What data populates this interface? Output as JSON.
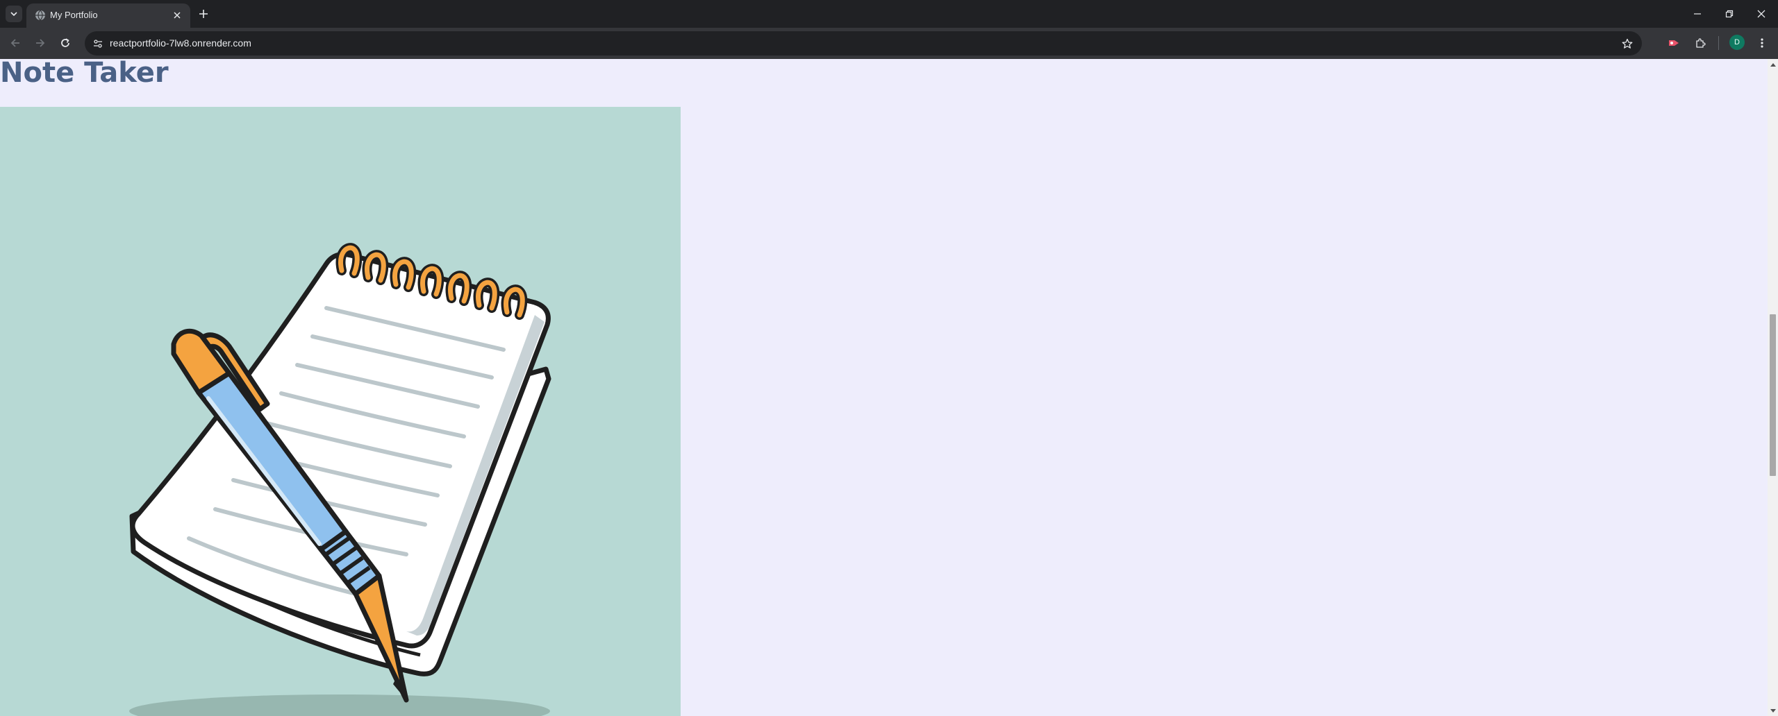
{
  "browser": {
    "tab": {
      "title": "My Portfolio"
    },
    "address_bar": {
      "url": "reactportfolio-7lw8.onrender.com"
    },
    "profile": {
      "initial": "D",
      "color": "#0f7a61"
    },
    "icons": [
      "tab-search-icon",
      "globe-icon",
      "close-icon",
      "plus-icon",
      "minimize-icon",
      "restore-icon",
      "back-arrow-icon",
      "forward-arrow-icon",
      "reload-icon",
      "site-info-icon",
      "star-icon",
      "extension-icon",
      "puzzle-icon",
      "kebab-menu-icon"
    ]
  },
  "page": {
    "project": {
      "title": "Note Taker",
      "image_subject": "notepad-with-pen-illustration"
    }
  },
  "colors": {
    "page_background": "#eeedfc",
    "title_color": "#4a6186",
    "image_background": "#b7d9d4",
    "accent_orange": "#f4a340",
    "pen_blue": "#8fc1ee"
  }
}
